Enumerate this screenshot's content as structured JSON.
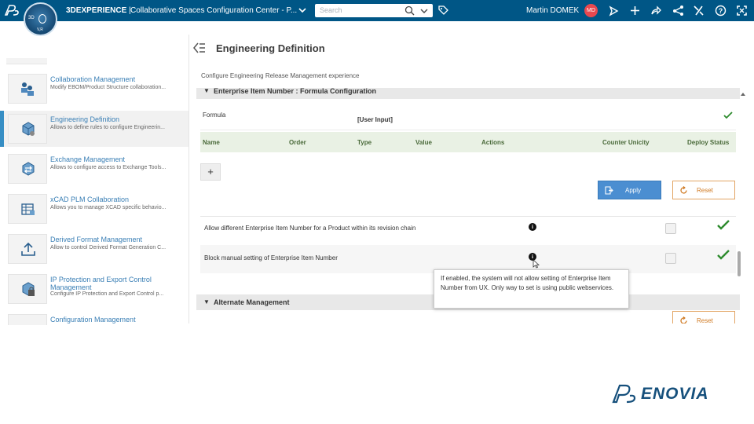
{
  "topbar": {
    "brand_bold": "3DEXPERIENCE",
    "brand_sep": " | ",
    "app_title": "Collaborative Spaces Configuration Center - P...",
    "search_placeholder": "Search",
    "user_name": "Martin DOMEK",
    "user_initials": "MD",
    "compass_label_3d": "3D",
    "compass_label_vr": "V,R",
    "accent_color": "#005686",
    "icons": [
      "ds-logo-icon",
      "compass-icon",
      "chevron-down-icon",
      "search-icon",
      "tag-icon",
      "feed-icon",
      "add-icon",
      "share-icon",
      "network-icon",
      "tools-icon",
      "help-icon",
      "expand-icon"
    ]
  },
  "sidebar": {
    "items": [
      {
        "title": "Collaboration Management",
        "desc": "Modify EBOM/Product Structure collaboration...",
        "icon": "people-cube-icon"
      },
      {
        "title": "Engineering Definition",
        "desc": "Allows to define rules to configure Engineerin...",
        "icon": "cube-gear-icon",
        "active": true
      },
      {
        "title": "Exchange Management",
        "desc": "Allows to configure access to Exchange Tools...",
        "icon": "exchange-icon"
      },
      {
        "title": "xCAD PLM Collaboration",
        "desc": "Allows you to manage XCAD specific behavio...",
        "icon": "xcad-icon"
      },
      {
        "title": "Derived Format Management",
        "desc": "Allow to control Derived Format Generation C...",
        "icon": "upload-icon"
      },
      {
        "title": "IP Protection and Export Control Management",
        "desc": "Configure IP Protection and Export Control p...",
        "icon": "ip-protection-icon"
      },
      {
        "title": "Configuration Management",
        "desc": "",
        "icon": "configuration-icon"
      }
    ]
  },
  "main": {
    "title": "Engineering Definition",
    "subtitle": "Configure Engineering Release Management experience",
    "section1_title": "Enterprise Item Number : Formula Configuration",
    "formula_label": "Formula",
    "formula_value": "[User Input]",
    "table_headers": [
      "Name",
      "Order",
      "Type",
      "Value",
      "Actions",
      "Counter Unicity",
      "Deploy Status"
    ],
    "add_label": "+",
    "apply_label": "Apply",
    "reset_label": "Reset",
    "options": [
      {
        "label": "Allow different Enterprise Item Number for a Product within its revision chain",
        "checked": false,
        "deployed": true
      },
      {
        "label": "Block manual setting of Enterprise Item Number",
        "checked": false,
        "deployed": true
      }
    ],
    "tooltip": "If enabled, the system will not allow setting of Enterprise Item Number from UX. Only way to set is using public webservices.",
    "section2_title": "Alternate Management",
    "reset2_label": "Reset"
  },
  "footer": {
    "logo_text": "ENOVIA"
  }
}
